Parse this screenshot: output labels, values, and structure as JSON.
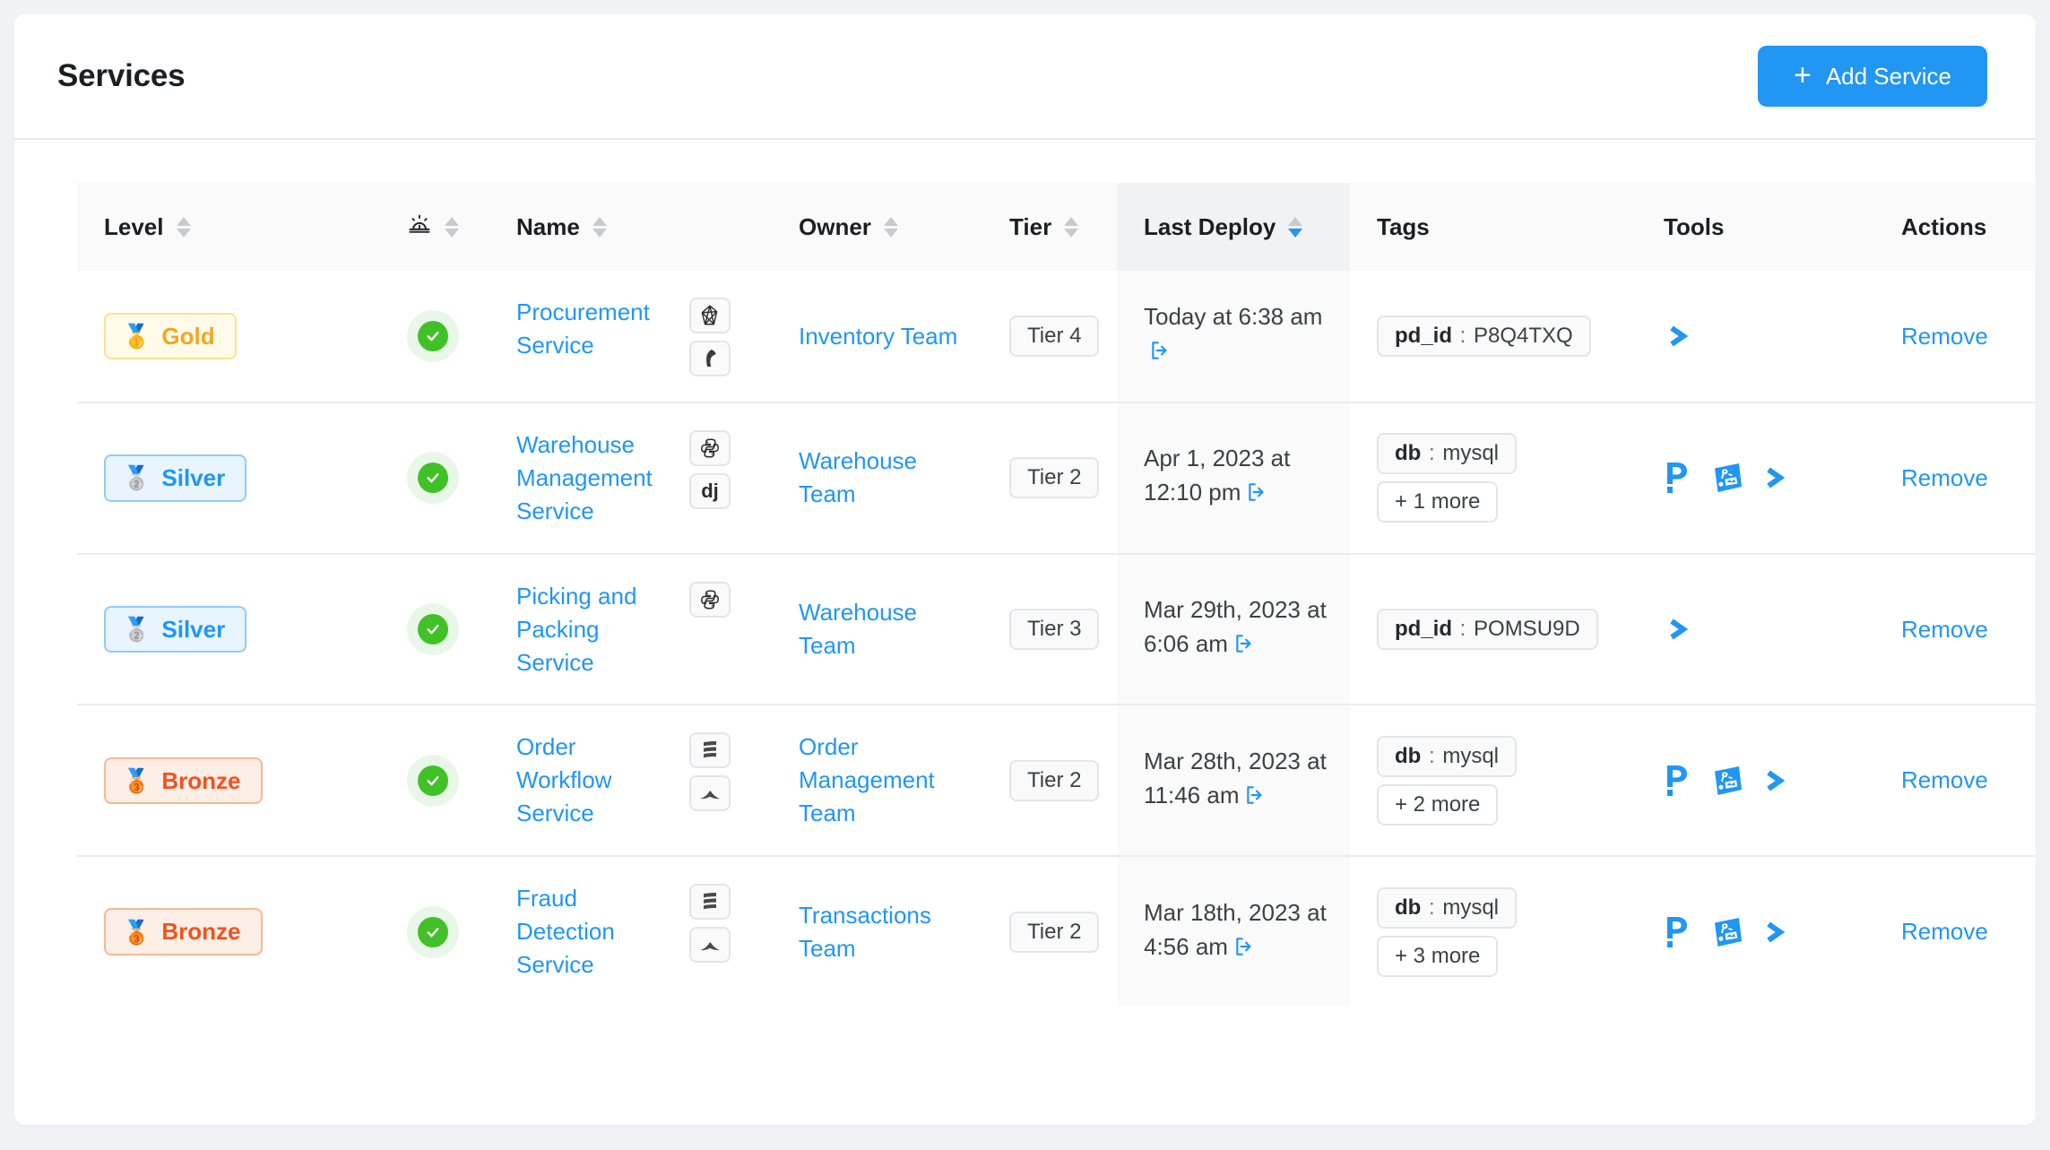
{
  "header": {
    "title": "Services",
    "add_button": {
      "label": "Add Service",
      "icon": "plus-icon",
      "color": "#2196f3"
    }
  },
  "table": {
    "columns": [
      {
        "key": "level",
        "label": "Level",
        "sortable": true,
        "sorted": false
      },
      {
        "key": "alarm",
        "label": "",
        "icon": "siren-icon",
        "sortable": true,
        "sorted": false
      },
      {
        "key": "name",
        "label": "Name",
        "sortable": true,
        "sorted": false
      },
      {
        "key": "owner",
        "label": "Owner",
        "sortable": true,
        "sorted": false
      },
      {
        "key": "tier",
        "label": "Tier",
        "sortable": true,
        "sorted": false
      },
      {
        "key": "deploy",
        "label": "Last Deploy",
        "sortable": true,
        "sorted": true,
        "direction": "desc"
      },
      {
        "key": "tags",
        "label": "Tags",
        "sortable": false,
        "sorted": false
      },
      {
        "key": "tools",
        "label": "Tools",
        "sortable": false,
        "sorted": false
      },
      {
        "key": "actions",
        "label": "Actions",
        "sortable": false,
        "sorted": false
      }
    ],
    "rows": [
      {
        "level": {
          "label": "Gold",
          "medal": "🥇",
          "style": "gold"
        },
        "health": "healthy",
        "name": "Procurement Service",
        "languages": [
          "ruby-icon",
          "rails-icon"
        ],
        "owner": "Inventory Team",
        "tier": "Tier 4",
        "deploy": "Today at 6:38 am",
        "tags": [
          {
            "key": "pd_id",
            "value": "P8Q4TXQ"
          }
        ],
        "more_tags": "",
        "tools": [
          "chevron-right-icon"
        ],
        "action": "Remove"
      },
      {
        "level": {
          "label": "Silver",
          "medal": "🥈",
          "style": "silver"
        },
        "health": "healthy",
        "name": "Warehouse Management Service",
        "languages": [
          "python-icon",
          "django-icon"
        ],
        "owner": "Warehouse Team",
        "tier": "Tier 2",
        "deploy": "Apr 1, 2023 at 12:10 pm",
        "tags": [
          {
            "key": "db",
            "value": "mysql"
          }
        ],
        "more_tags": "+ 1 more",
        "tools": [
          "pagerduty-icon",
          "datadog-icon",
          "chevron-right-icon"
        ],
        "action": "Remove"
      },
      {
        "level": {
          "label": "Silver",
          "medal": "🥈",
          "style": "silver"
        },
        "health": "healthy",
        "name": "Picking and Packing Service",
        "languages": [
          "python-icon"
        ],
        "owner": "Warehouse Team",
        "tier": "Tier 3",
        "deploy": "Mar 29th, 2023 at 6:06 am",
        "tags": [
          {
            "key": "pd_id",
            "value": "POMSU9D"
          }
        ],
        "more_tags": "",
        "tools": [
          "chevron-right-icon"
        ],
        "action": "Remove"
      },
      {
        "level": {
          "label": "Bronze",
          "medal": "🥉",
          "style": "bronze"
        },
        "health": "healthy",
        "name": "Order Workflow Service",
        "languages": [
          "scala-icon",
          "spark-icon"
        ],
        "owner": "Order Management Team",
        "tier": "Tier 2",
        "deploy": "Mar 28th, 2023 at 11:46 am",
        "tags": [
          {
            "key": "db",
            "value": "mysql"
          }
        ],
        "more_tags": "+ 2 more",
        "tools": [
          "pagerduty-icon",
          "datadog-icon",
          "chevron-right-icon"
        ],
        "action": "Remove"
      },
      {
        "level": {
          "label": "Bronze",
          "medal": "🥉",
          "style": "bronze"
        },
        "health": "healthy",
        "name": "Fraud Detection Service",
        "languages": [
          "scala-icon",
          "spark-icon"
        ],
        "owner": "Transactions Team",
        "tier": "Tier 2",
        "deploy": "Mar 18th, 2023 at 4:56 am",
        "tags": [
          {
            "key": "db",
            "value": "mysql"
          }
        ],
        "more_tags": "+ 3 more",
        "tools": [
          "pagerduty-icon",
          "datadog-icon",
          "chevron-right-icon"
        ],
        "action": "Remove"
      }
    ]
  }
}
